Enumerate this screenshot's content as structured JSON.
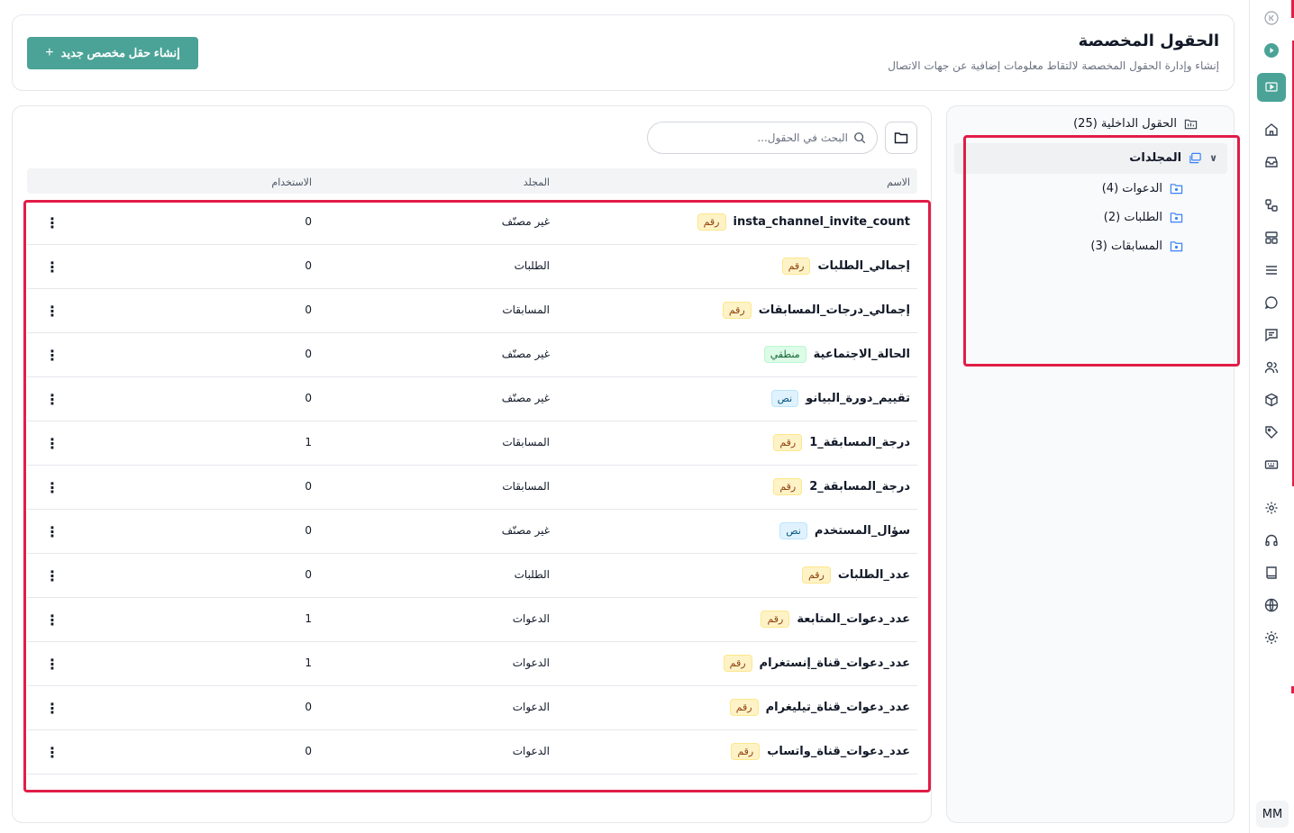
{
  "header": {
    "title": "الحقول المخصصة",
    "subtitle": "إنشاء وإدارة الحقول المخصصة لالتقاط معلومات إضافية عن جهات الاتصال",
    "create_button": "إنشاء حقل مخصص جديد"
  },
  "folders": {
    "builtin_label": "الحقول الداخلية (25)",
    "folders_label": "المجلدات",
    "items": [
      {
        "label": "الدعوات (4)"
      },
      {
        "label": "الطلبات (2)"
      },
      {
        "label": "المسابقات (3)"
      }
    ]
  },
  "search": {
    "placeholder": "البحث في الحقول..."
  },
  "table": {
    "headers": {
      "name": "الاسم",
      "folder": "المجلد",
      "usage": "الاستخدام"
    },
    "rows": [
      {
        "name": "insta_channel_invite_count",
        "type": "رقم",
        "type_kind": "num",
        "folder": "غير مصنّف",
        "usage": "0"
      },
      {
        "name": "إجمالي_الطلبات",
        "type": "رقم",
        "type_kind": "num",
        "folder": "الطلبات",
        "usage": "0"
      },
      {
        "name": "إجمالي_درجات_المسابقات",
        "type": "رقم",
        "type_kind": "num",
        "folder": "المسابقات",
        "usage": "0"
      },
      {
        "name": "الحالة_الاجتماعية",
        "type": "منطقي",
        "type_kind": "bool",
        "folder": "غير مصنّف",
        "usage": "0"
      },
      {
        "name": "تقييم_دورة_البيانو",
        "type": "نص",
        "type_kind": "text",
        "folder": "غير مصنّف",
        "usage": "0"
      },
      {
        "name": "درجة_المسابقة_1",
        "type": "رقم",
        "type_kind": "num",
        "folder": "المسابقات",
        "usage": "1"
      },
      {
        "name": "درجة_المسابقة_2",
        "type": "رقم",
        "type_kind": "num",
        "folder": "المسابقات",
        "usage": "0"
      },
      {
        "name": "سؤال_المستخدم",
        "type": "نص",
        "type_kind": "text",
        "folder": "غير مصنّف",
        "usage": "0"
      },
      {
        "name": "عدد_الطلبات",
        "type": "رقم",
        "type_kind": "num",
        "folder": "الطلبات",
        "usage": "0"
      },
      {
        "name": "عدد_دعوات_المتابعة",
        "type": "رقم",
        "type_kind": "num",
        "folder": "الدعوات",
        "usage": "1"
      },
      {
        "name": "عدد_دعوات_قناة_إنستغرام",
        "type": "رقم",
        "type_kind": "num",
        "folder": "الدعوات",
        "usage": "1"
      },
      {
        "name": "عدد_دعوات_قناة_تيليغرام",
        "type": "رقم",
        "type_kind": "num",
        "folder": "الدعوات",
        "usage": "0"
      },
      {
        "name": "عدد_دعوات_قناة_واتساب",
        "type": "رقم",
        "type_kind": "num",
        "folder": "الدعوات",
        "usage": "0"
      }
    ]
  },
  "user": {
    "initials": "MM"
  },
  "colors": {
    "accent": "#4aa396",
    "highlight": "#e11d48"
  },
  "rail_icons": [
    "collapse-icon",
    "video-icon",
    "video-icon",
    "home-icon",
    "inbox-icon",
    "flow-icon",
    "layout-icon",
    "list-icon",
    "chat-icon",
    "message-icon",
    "users-icon",
    "box-icon",
    "tag-icon",
    "keyboard-icon",
    "settings-icon",
    "headset-icon",
    "book-icon",
    "globe-icon",
    "sun-icon"
  ]
}
